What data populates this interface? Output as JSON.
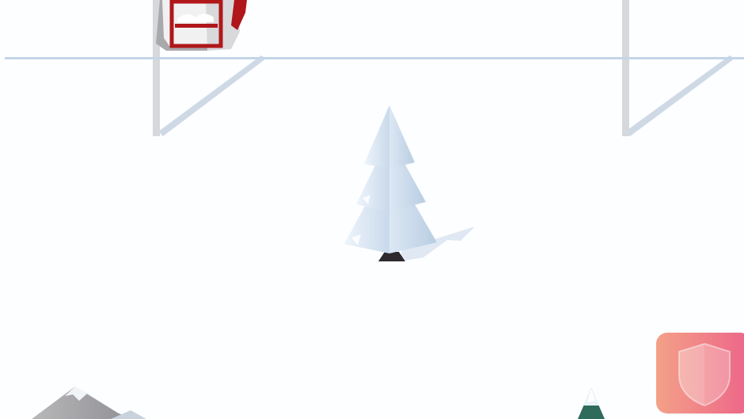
{
  "game": {
    "scene": "ski-slope",
    "background_color": "#fdfeff",
    "cable_color": "#c3d5e9",
    "tower_color": "#d6d8dc",
    "gondola_color": "#b0171a",
    "tree_snow_color": "#eaf2fb",
    "tree_shadow_color": "#dfe8f3",
    "shield_button": {
      "icon": "shield-icon",
      "gradient_start": "#f4a188",
      "gradient_end": "#ec6488"
    }
  }
}
